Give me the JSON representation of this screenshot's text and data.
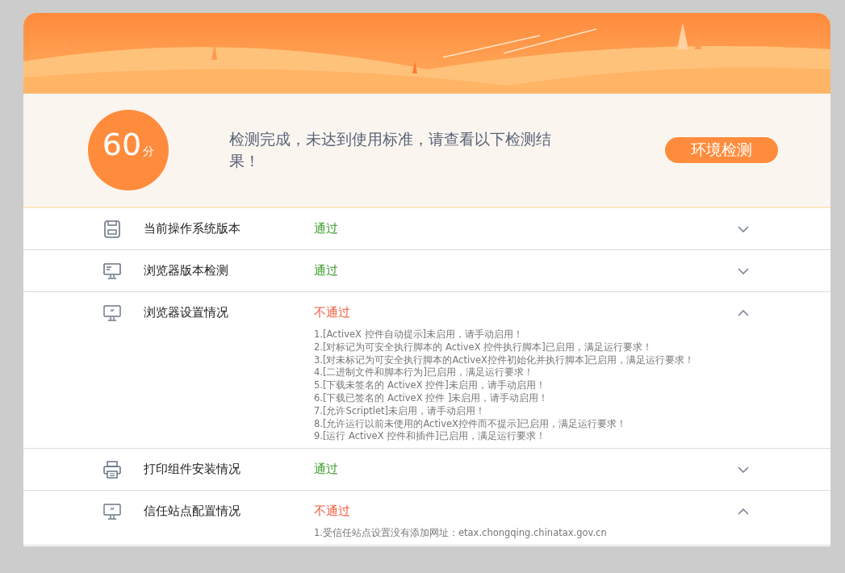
{
  "score": {
    "value": "60",
    "unit": "分"
  },
  "message": "检测完成，未达到使用标准，请查看以下检测结果！",
  "action_button": "环境检测",
  "checks": [
    {
      "kind": "disk",
      "label": "当前操作系统版本",
      "status": "通过",
      "passed": true,
      "expanded": false
    },
    {
      "kind": "monitor",
      "label": "浏览器版本检测",
      "status": "通过",
      "passed": true,
      "expanded": false
    },
    {
      "kind": "display",
      "label": "浏览器设置情况",
      "status": "不通过",
      "passed": false,
      "expanded": true,
      "details": [
        "1.[ActiveX 控件自动提示]未启用，请手动启用！",
        "2.[对标记为可安全执行脚本的 ActiveX 控件执行脚本]已启用，满足运行要求！",
        "3.[对未标记为可安全执行脚本的ActiveX控件初始化并执行脚本]已启用，满足运行要求！",
        "4.[二进制文件和脚本行为]已启用，满足运行要求！",
        "5.[下载未签名的 ActiveX 控件]未启用，请手动启用！",
        "6.[下载已签名的 ActiveX 控件 ]未启用，请手动启用！",
        "7.[允许Scriptlet]未启用，请手动启用！",
        "8.[允许运行以前未使用的ActiveX控件而不提示]已启用，满足运行要求！",
        "9.[运行 ActiveX 控件和插件]已启用，满足运行要求！"
      ]
    },
    {
      "kind": "printer",
      "label": "打印组件安装情况",
      "status": "通过",
      "passed": true,
      "expanded": false
    },
    {
      "kind": "display",
      "label": "信任站点配置情况",
      "status": "不通过",
      "passed": false,
      "expanded": true,
      "details": [
        "1.受信任站点设置没有添加网址：etax.chongqing.chinatax.gov.cn"
      ]
    }
  ]
}
